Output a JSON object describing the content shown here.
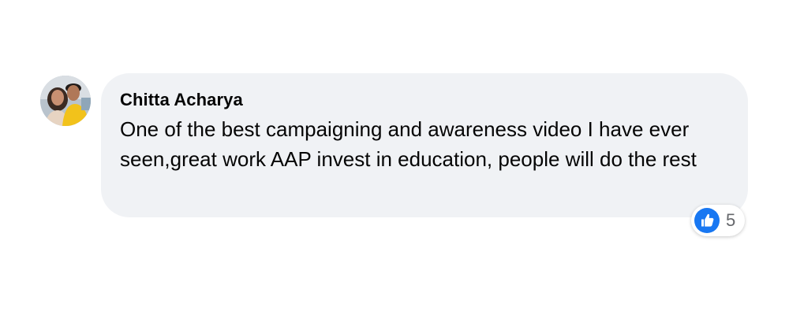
{
  "comment": {
    "author": "Chitta Acharya",
    "text": "One of the best campaigning and awareness video I have ever seen,great work AAP invest in education, people will do the rest",
    "avatar_icon": "profile-photo",
    "bubble_color": "#f0f2f5"
  },
  "reactions": {
    "icon": "like-icon",
    "icon_color": "#1877f2",
    "count": "5"
  }
}
